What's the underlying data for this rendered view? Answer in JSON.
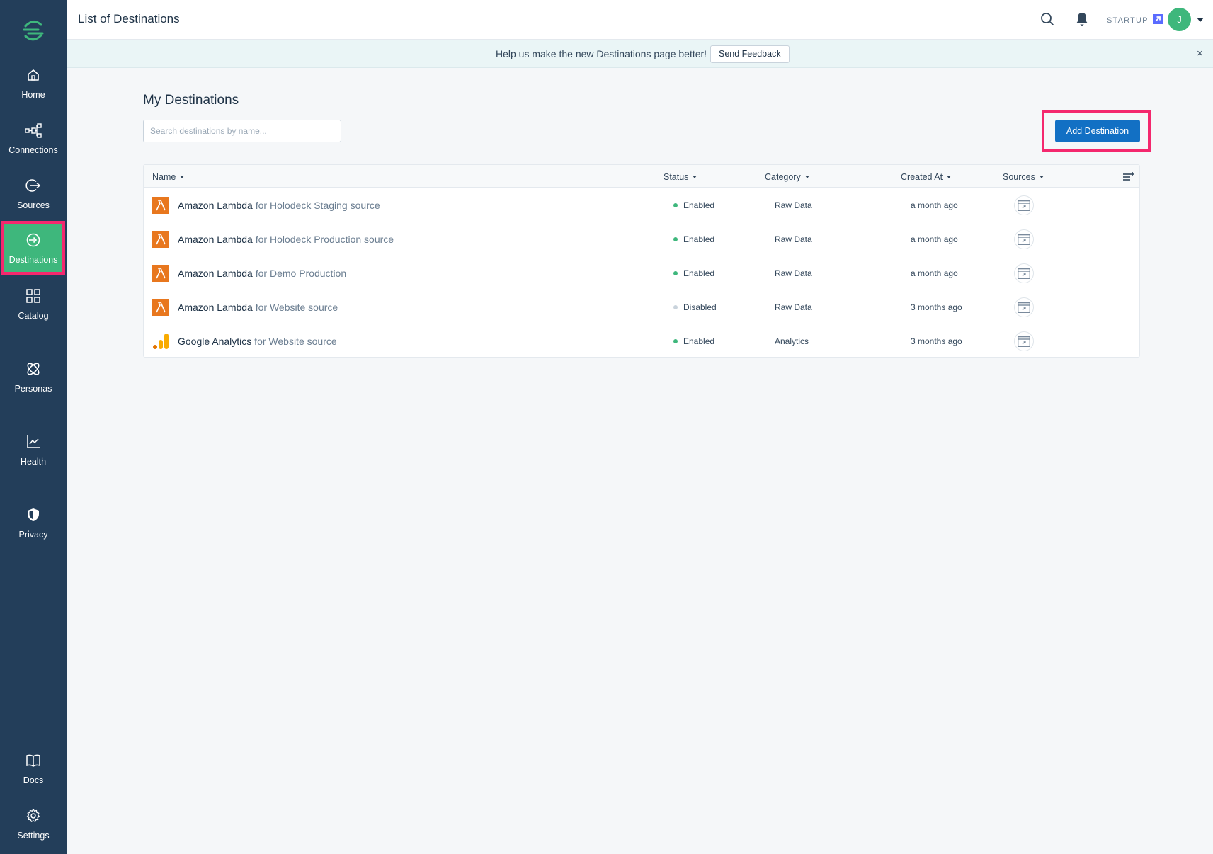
{
  "topbar": {
    "title": "List of Destinations",
    "plan": "STARTUP",
    "avatar_initial": "J"
  },
  "banner": {
    "text": "Help us make the new Destinations page better!",
    "button": "Send Feedback",
    "close": "×"
  },
  "sidebar": {
    "items": [
      {
        "label": "Home",
        "icon": "home-icon"
      },
      {
        "label": "Connections",
        "icon": "connections-icon"
      },
      {
        "label": "Sources",
        "icon": "sources-icon"
      },
      {
        "label": "Destinations",
        "icon": "destinations-icon",
        "active": true
      },
      {
        "label": "Catalog",
        "icon": "catalog-icon"
      },
      {
        "label": "Personas",
        "icon": "personas-icon"
      },
      {
        "label": "Health",
        "icon": "health-icon"
      },
      {
        "label": "Privacy",
        "icon": "privacy-icon"
      },
      {
        "label": "Docs",
        "icon": "docs-icon"
      },
      {
        "label": "Settings",
        "icon": "settings-icon"
      }
    ]
  },
  "main": {
    "title": "My Destinations",
    "search_placeholder": "Search destinations by name...",
    "add_button": "Add Destination"
  },
  "table": {
    "columns": [
      "Name",
      "Status",
      "Category",
      "Created At",
      "Sources"
    ],
    "rows": [
      {
        "destination": "Amazon Lambda",
        "source": " for Holodeck Staging source",
        "status": "Enabled",
        "category": "Raw Data",
        "created": "a month ago",
        "logo": "lambda-icon"
      },
      {
        "destination": "Amazon Lambda",
        "source": " for Holodeck Production source",
        "status": "Enabled",
        "category": "Raw Data",
        "created": "a month ago",
        "logo": "lambda-icon"
      },
      {
        "destination": "Amazon Lambda",
        "source": " for Demo Production",
        "status": "Enabled",
        "category": "Raw Data",
        "created": "a month ago",
        "logo": "lambda-icon"
      },
      {
        "destination": "Amazon Lambda",
        "source": " for Website source",
        "status": "Disabled",
        "category": "Raw Data",
        "created": "3 months ago",
        "logo": "lambda-icon"
      },
      {
        "destination": "Google Analytics",
        "source": " for Website source",
        "status": "Enabled",
        "category": "Analytics",
        "created": "3 months ago",
        "logo": "google-analytics-icon"
      }
    ]
  },
  "colors": {
    "sidebar": "#233e5a",
    "active": "#3eb77c",
    "highlight": "#f4286e",
    "primary": "#1270c4",
    "enabled": "#3eb77c",
    "disabled": "#c9d3dc",
    "lambda": "#e8771e"
  }
}
